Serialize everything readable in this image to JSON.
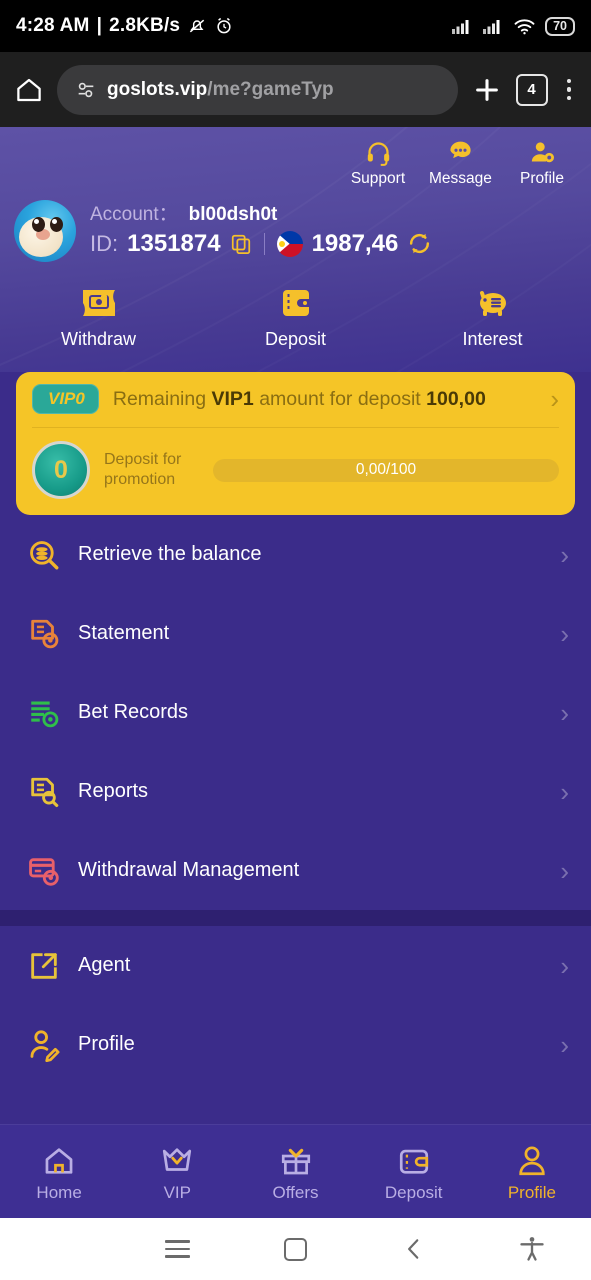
{
  "status_bar": {
    "time": "4:28 AM",
    "separator": "|",
    "network_speed": "2.8KB/s",
    "mute_icon": "bell-muted-icon",
    "alarm_icon": "alarm-clock-icon",
    "signal_icon_1": "cellular-signal-icon",
    "signal_icon_2": "cellular-signal-icon",
    "wifi_icon": "wifi-icon",
    "battery_level": "70"
  },
  "browser": {
    "home_icon": "home-icon",
    "site_settings_icon": "site-settings-icon",
    "url_domain": "goslots.vip",
    "url_path": "/me?gameTyp",
    "new_tab_icon": "plus-icon",
    "tab_count": "4",
    "menu_icon": "overflow-menu-icon"
  },
  "header": {
    "top_icons": [
      {
        "name": "support",
        "label": "Support",
        "icon": "headset-icon"
      },
      {
        "name": "message",
        "label": "Message",
        "icon": "chat-bubble-icon"
      },
      {
        "name": "profile",
        "label": "Profile",
        "icon": "user-gear-icon"
      }
    ],
    "avatar_icon": "pufferfish-avatar",
    "account_label": "Account：",
    "account_value": "bl00dsh0t",
    "id_label": "ID:",
    "id_value": "1351874",
    "copy_icon": "copy-icon",
    "flag_icon": "philippines-flag-icon",
    "balance": "1987,46",
    "refresh_icon": "refresh-icon"
  },
  "quick_actions": [
    {
      "name": "withdraw",
      "label": "Withdraw",
      "icon": "withdraw-ticket-icon"
    },
    {
      "name": "deposit",
      "label": "Deposit",
      "icon": "wallet-icon"
    },
    {
      "name": "interest",
      "label": "Interest",
      "icon": "piggy-bank-icon"
    }
  ],
  "vip_card": {
    "badge": "VIP0",
    "text_prefix": "Remaining ",
    "text_level": "VIP1",
    "text_middle": " amount for deposit ",
    "text_amount": "100,00",
    "chevron_icon": "chevron-right-icon",
    "coin_value": "0",
    "promo_label": "Deposit for promotion",
    "progress_text": "0,00/100",
    "progress_percent": 0,
    "colors": {
      "card_bg": "#F5C527",
      "badge_bg": "#2AA898",
      "track": "#E3B62B"
    }
  },
  "menu": {
    "group1": [
      {
        "name": "retrieve-the-balance",
        "label": "Retrieve the balance",
        "icon": "coins-search-icon",
        "color": "#F0B32B"
      },
      {
        "name": "statement",
        "label": "Statement",
        "icon": "document-clock-icon",
        "color": "#E8833A"
      },
      {
        "name": "bet-records",
        "label": "Bet Records",
        "icon": "list-clock-icon",
        "color": "#2FBF4A"
      },
      {
        "name": "reports",
        "label": "Reports",
        "icon": "document-search-icon",
        "color": "#E8C33A"
      },
      {
        "name": "withdrawal-management",
        "label": "Withdrawal Management",
        "icon": "card-gear-icon",
        "color": "#E8606A"
      }
    ],
    "group2": [
      {
        "name": "agent",
        "label": "Agent",
        "icon": "share-box-icon",
        "color": "#E8C33A"
      },
      {
        "name": "profile",
        "label": "Profile",
        "icon": "user-edit-icon",
        "color": "#F0B32B"
      }
    ],
    "chevron_icon": "chevron-right-icon"
  },
  "bottom_nav": {
    "active": "Profile",
    "items": [
      {
        "name": "home",
        "label": "Home",
        "icon": "home-icon"
      },
      {
        "name": "vip",
        "label": "VIP",
        "icon": "crown-icon"
      },
      {
        "name": "offers",
        "label": "Offers",
        "icon": "gift-icon"
      },
      {
        "name": "deposit",
        "label": "Deposit",
        "icon": "wallet-icon"
      },
      {
        "name": "profile",
        "label": "Profile",
        "icon": "person-icon"
      }
    ]
  },
  "system_nav": {
    "menu_icon": "menu-icon",
    "recents_icon": "square-recents-icon",
    "back_icon": "back-chevron-icon",
    "accessibility_icon": "accessibility-icon"
  },
  "theme": {
    "bg": "#3B2C8A",
    "divider": "#2E2070",
    "accent_yellow": "#F0B32B",
    "nav_bg": "#3E2F93"
  }
}
